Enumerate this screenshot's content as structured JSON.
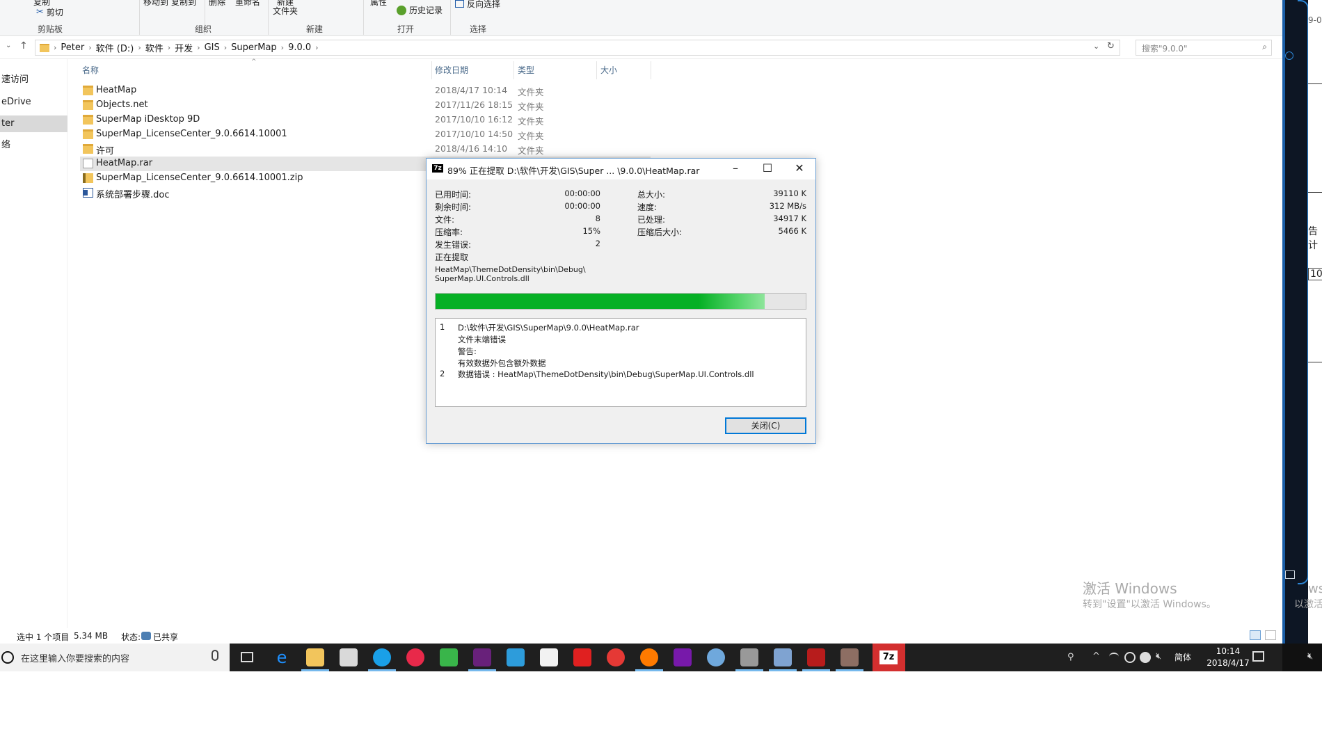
{
  "ribbon": {
    "top_labels": [
      "复制",
      "移动到",
      "复制到",
      "删除",
      "重命名",
      "新建"
    ],
    "cut_label": "剪切",
    "new_folder_label": "文件夹",
    "open_more_label": "属性",
    "history_label": "历史记录",
    "invert_select_label": "反向选择",
    "groups": [
      "剪贴板",
      "组织",
      "新建",
      "打开",
      "选择"
    ]
  },
  "address": {
    "breadcrumbs": [
      "Peter",
      "软件 (D:)",
      "软件",
      "开发",
      "GIS",
      "SuperMap",
      "9.0.0"
    ],
    "search_placeholder": "搜索\"9.0.0\""
  },
  "sidebar": {
    "items": [
      {
        "label": "速访问"
      },
      {
        "label": "eDrive"
      },
      {
        "label": "ter"
      },
      {
        "label": "络"
      }
    ]
  },
  "columns": [
    "名称",
    "修改日期",
    "类型",
    "大小"
  ],
  "files": [
    {
      "name": "HeatMap",
      "date": "2018/4/17 10:14",
      "type": "文件夹",
      "icon": "folder-icon"
    },
    {
      "name": "Objects.net",
      "date": "2017/11/26 18:15",
      "type": "文件夹",
      "icon": "folder-icon"
    },
    {
      "name": "SuperMap iDesktop 9D",
      "date": "2017/10/10 16:12",
      "type": "文件夹",
      "icon": "folder-icon"
    },
    {
      "name": "SuperMap_LicenseCenter_9.0.6614.10001",
      "date": "2017/10/10 14:50",
      "type": "文件夹",
      "icon": "folder-icon"
    },
    {
      "name": "许可",
      "date": "2018/4/16 14:10",
      "type": "文件夹",
      "icon": "folder-icon"
    },
    {
      "name": "HeatMap.rar",
      "date": "",
      "type": "",
      "icon": "file-icon"
    },
    {
      "name": "SuperMap_LicenseCenter_9.0.6614.10001.zip",
      "date": "",
      "type": "",
      "icon": "zip-icon"
    },
    {
      "name": "系统部署步骤.doc",
      "date": "",
      "type": "",
      "icon": "doc-icon"
    }
  ],
  "status": {
    "selected": "选中 1 个项目",
    "size": "5.34 MB",
    "state_label": "状态:",
    "state_value": "已共享"
  },
  "watermark": {
    "line1": "激活 Windows",
    "line2": "转到\"设置\"以激活 Windows。"
  },
  "desktop_strip": {
    "t1": "9-0",
    "t2": "告计",
    "t3": "10",
    "t4": "ws",
    "t5": "以激活 V"
  },
  "taskbar": {
    "search_placeholder": "在这里输入你要搜索的内容",
    "ime": "简体",
    "time": "10:14",
    "date": "2018/4/17"
  },
  "dialog": {
    "title": "89% 正在提取 D:\\软件\\开发\\GIS\\Super ... \\9.0.0\\HeatMap.rar",
    "progress_percent": 89,
    "stats_left": [
      {
        "label": "已用时间:",
        "value": "00:00:00"
      },
      {
        "label": "剩余时间:",
        "value": "00:00:00"
      },
      {
        "label": "文件:",
        "value": "8"
      },
      {
        "label": "压缩率:",
        "value": "15%"
      },
      {
        "label": "发生错误:",
        "value": "2"
      }
    ],
    "stats_right": [
      {
        "label": "总大小:",
        "value": "39110 K"
      },
      {
        "label": "速度:",
        "value": "312 MB/s"
      },
      {
        "label": "已处理:",
        "value": "34917 K"
      },
      {
        "label": "压缩后大小:",
        "value": "5466 K"
      }
    ],
    "status_text": "正在提取",
    "current_path_line1": "HeatMap\\ThemeDotDensity\\bin\\Debug\\",
    "current_path_line2": "SuperMap.UI.Controls.dll",
    "messages": [
      {
        "num": "1",
        "text": "D:\\软件\\开发\\GIS\\SuperMap\\9.0.0\\HeatMap.rar"
      },
      {
        "num": "",
        "text": "文件末端错误"
      },
      {
        "num": "",
        "text": "警告:"
      },
      {
        "num": "",
        "text": "有效数据外包含额外数据"
      },
      {
        "num": "2",
        "text": "数据错误 : HeatMap\\ThemeDotDensity\\bin\\Debug\\SuperMap.UI.Controls.dll"
      }
    ],
    "close_label": "关闭(C)",
    "app_icon_label": "7z"
  },
  "colors": {
    "progress_green": "#06b025",
    "accent_blue": "#0078d7"
  }
}
